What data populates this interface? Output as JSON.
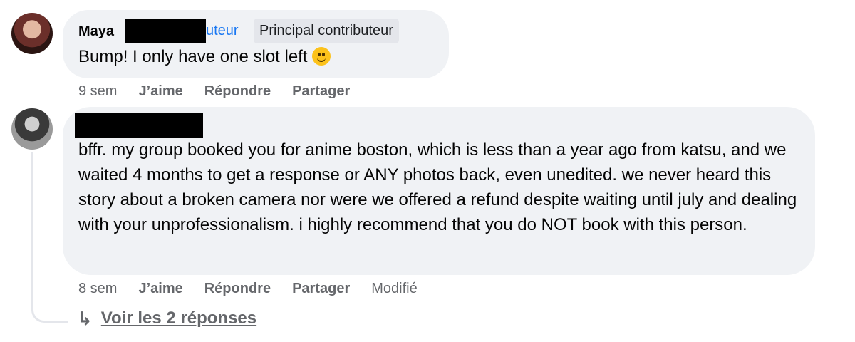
{
  "comments": [
    {
      "author_first": "Maya",
      "role_partial": "uteur",
      "badge": "Principal contributeur",
      "text": "Bump! I only have one slot left",
      "emoji": "smiling-face",
      "actions": {
        "time": "9 sem",
        "like": "J’aime",
        "reply": "Répondre",
        "share": "Partager"
      }
    },
    {
      "text": "bffr. my group booked you for anime boston, which is less than a year ago from katsu, and we waited 4 months to get a response or ANY photos back, even unedited. we never heard this story about a broken camera nor were we offered a refund despite waiting until july and dealing with your unprofessionalism. i highly recommend that you do NOT book with this person.",
      "actions": {
        "time": "8 sem",
        "like": "J’aime",
        "reply": "Répondre",
        "share": "Partager",
        "edited": "Modifié"
      }
    }
  ],
  "replies_link": {
    "icon": "reply-arrow-icon",
    "label": "Voir les 2 réponses"
  },
  "colors": {
    "bubble": "#f0f2f5",
    "badge_bg": "#e4e6eb",
    "secondary_text": "#65676b",
    "link_blue": "#1877f2"
  }
}
